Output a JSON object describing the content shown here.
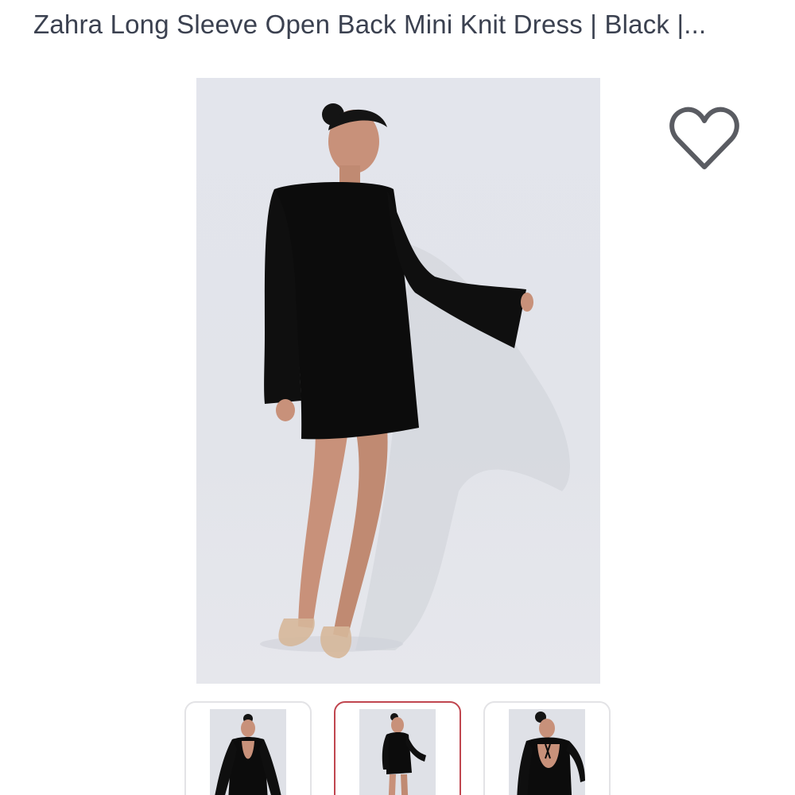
{
  "product": {
    "title": "Zahra Long Sleeve Open Back Mini Knit Dress | Black |..."
  },
  "gallery": {
    "main_image": "model-front-black-dress",
    "selected_index": 1,
    "thumbnails": [
      {
        "image": "model-back-open-dress"
      },
      {
        "image": "model-front-black-dress"
      },
      {
        "image": "model-back-tie-dress"
      }
    ]
  },
  "actions": {
    "favorite_icon": "heart-outline-icon"
  },
  "colors": {
    "title": "#3b4150",
    "selected_thumb_border": "#c0464f",
    "thumb_border": "#e3e3e6",
    "icon": "#5a5c62"
  }
}
